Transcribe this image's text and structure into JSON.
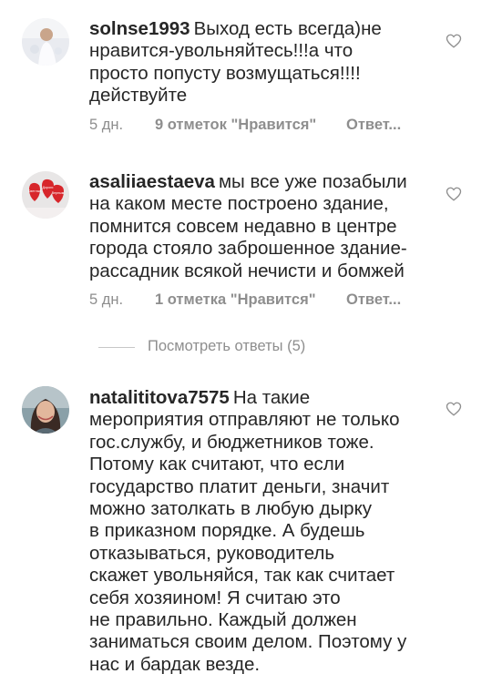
{
  "comments": [
    {
      "username": "solnse1993",
      "lines": [
        "Выход есть всегда)не",
        "нравится-увольняйтесь!!!а что",
        "просто попусту возмущаться!!!!",
        "действуйте"
      ],
      "time": "5 дн.",
      "likes": "9 отметок \"Нравится\"",
      "reply": "Ответ..."
    },
    {
      "username": "asaliiaestaeva",
      "lines": [
        "мы все уже позабыли",
        "на каком месте построено здание,",
        "помнится совсем недавно в центре",
        "города стояло заброшенное здание-",
        "рассадник  всякой нечисти и бомжей"
      ],
      "time": "5 дн.",
      "likes": "1 отметка \"Нравится\"",
      "reply": "Ответ..."
    },
    {
      "username": "natalititova7575",
      "lines": [
        "На такие",
        "мероприятия отправляют не только",
        "гос.службу, и бюджетников тоже.",
        "Потому как считают, что если",
        "государство платит деньги, значит",
        "можно затолкать в любую дырку",
        "в приказном порядке. А будешь",
        "отказываться, руководитель",
        "скажет увольняйся, так как считает",
        "себя хозяином! Я считаю это",
        "не правильно. Каждый должен",
        "заниматься своим делом. Поэтому у",
        "нас и бардак везде."
      ]
    }
  ],
  "view_replies": "Посмотреть ответы (5)",
  "avatar_labels": [
    "Светлые",
    "Дороги",
    "Верным"
  ],
  "colors": {
    "text": "#262626",
    "meta": "#8e8e8e",
    "background": "#ffffff"
  },
  "icons": [
    "heart-icon"
  ]
}
